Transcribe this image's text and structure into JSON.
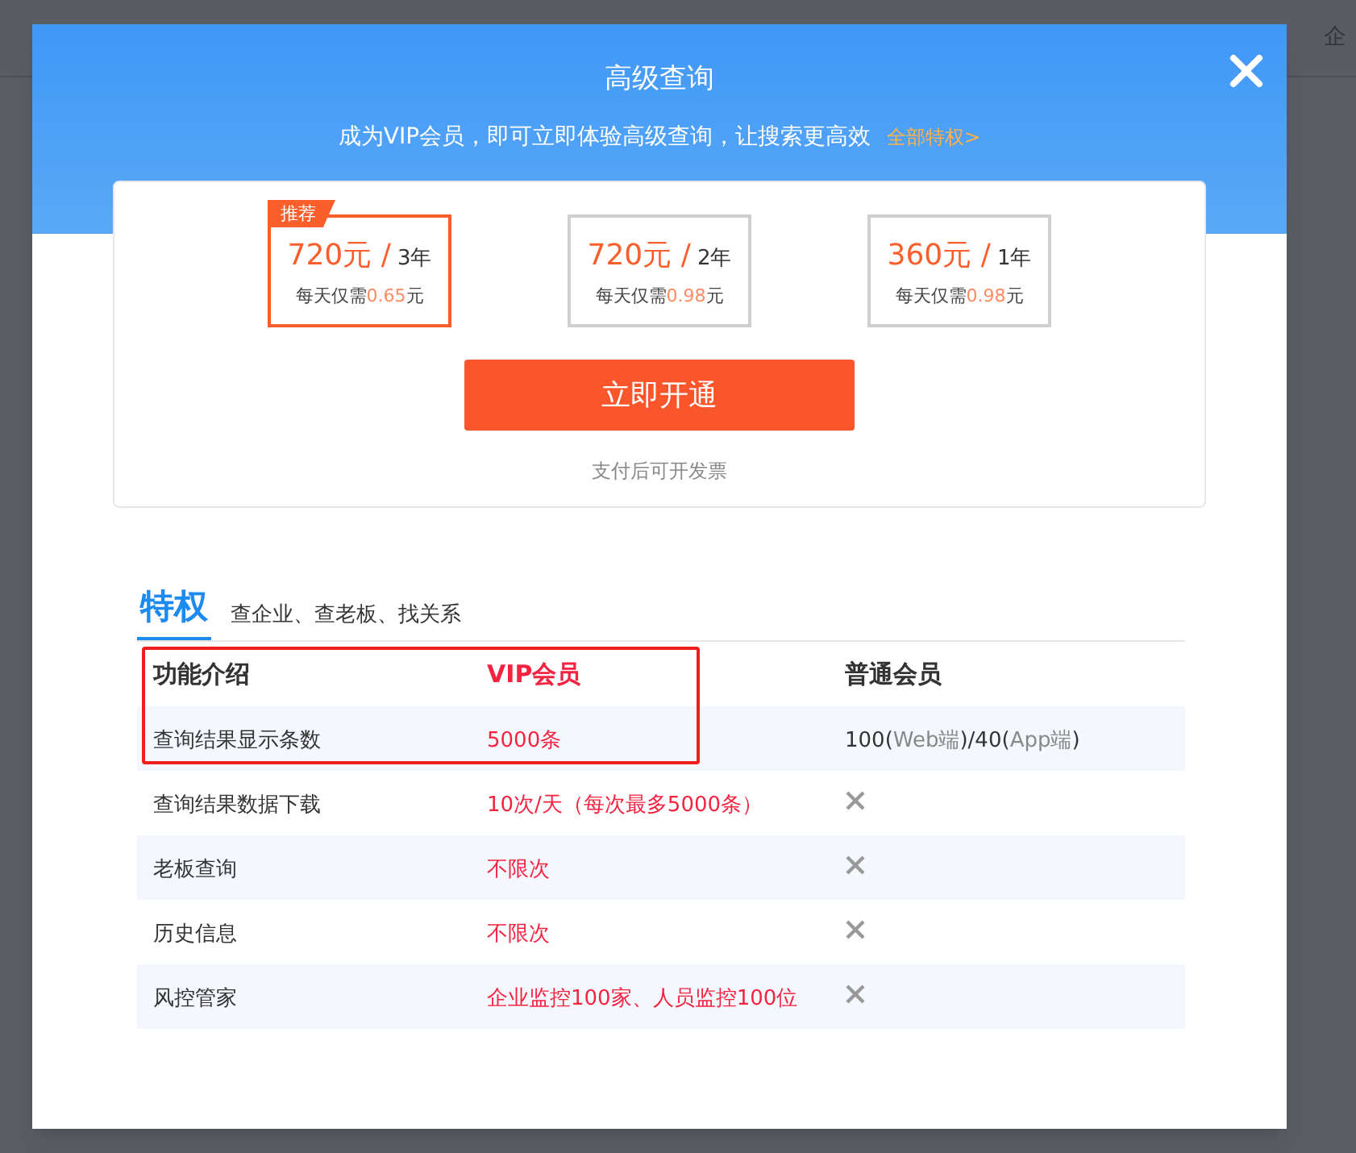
{
  "background_header": {
    "nav": [
      "企"
    ]
  },
  "modal": {
    "title": "高级查询",
    "subtitle": "成为VIP会员，即可立即体验高级查询，让搜索更高效",
    "all_privileges_link": "全部特权>",
    "plans": [
      {
        "badge": "推荐",
        "price": "720元 /",
        "period": "3年",
        "daily_prefix": "每天仅需",
        "daily_amount": "0.65",
        "daily_suffix": "元",
        "selected": true
      },
      {
        "price": "720元 /",
        "period": "2年",
        "daily_prefix": "每天仅需",
        "daily_amount": "0.98",
        "daily_suffix": "元",
        "selected": false
      },
      {
        "price": "360元 /",
        "period": "1年",
        "daily_prefix": "每天仅需",
        "daily_amount": "0.98",
        "daily_suffix": "元",
        "selected": false
      }
    ],
    "open_button": "立即开通",
    "invoice_note": "支付后可开发票",
    "tabs": [
      {
        "label": "特权",
        "selected": true
      },
      {
        "label": "查企业、查老板、找关系",
        "selected": false
      }
    ],
    "table": {
      "columns": [
        "功能介绍",
        "VIP会员",
        "普通会员"
      ],
      "rows": [
        {
          "feature": "查询结果显示条数",
          "vip": "5000条",
          "normal": {
            "kind": "text",
            "parts": [
              {
                "text": "100(",
                "muted": false
              },
              {
                "text": "Web端",
                "muted": true
              },
              {
                "text": ")/40(",
                "muted": false
              },
              {
                "text": "App端",
                "muted": true
              },
              {
                "text": ")",
                "muted": false
              }
            ]
          }
        },
        {
          "feature": "查询结果数据下载",
          "vip": "10次/天（每次最多5000条）",
          "normal": {
            "kind": "cross"
          }
        },
        {
          "feature": "老板查询",
          "vip": "不限次",
          "normal": {
            "kind": "cross"
          }
        },
        {
          "feature": "历史信息",
          "vip": "不限次",
          "normal": {
            "kind": "cross"
          }
        },
        {
          "feature": "风控管家",
          "vip": "企业监控100家、人员监控100位",
          "normal": {
            "kind": "cross"
          }
        }
      ]
    }
  }
}
